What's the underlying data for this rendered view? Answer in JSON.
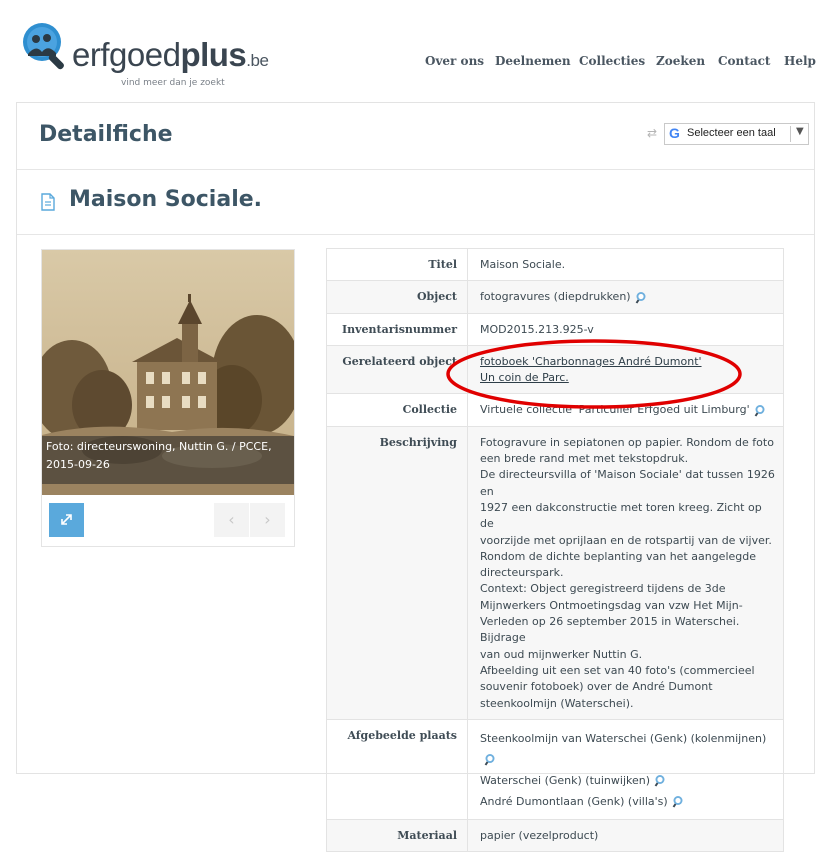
{
  "header": {
    "logo_main": "erfgoed",
    "logo_bold": "plus",
    "logo_tld": ".be",
    "tagline": "vind meer dan je zoekt",
    "nav": [
      "Over ons",
      "Deelnemen",
      "Collecties",
      "Zoeken",
      "Contact",
      "Help"
    ]
  },
  "page": {
    "title": "Detailfiche",
    "object_title": "Maison Sociale."
  },
  "translate": {
    "logo_letter": "G",
    "label": "Selecteer een taal",
    "arrow": "▼",
    "swap": "⇄"
  },
  "image": {
    "caption": "Foto: directeurswoning, Nuttin G. / PCCE, 2015-09-26",
    "prev": "‹",
    "next": "›"
  },
  "details": {
    "titel": {
      "label": "Titel",
      "value": "Maison Sociale."
    },
    "object": {
      "label": "Object",
      "value": "fotogravures (diepdrukken)"
    },
    "inventaris": {
      "label": "Inventarisnummer",
      "value": "MOD2015.213.925-v"
    },
    "gerelateerd": {
      "label": "Gerelateerd object",
      "links": [
        "fotoboek 'Charbonnages André Dumont'",
        "Un coin de Parc."
      ]
    },
    "collectie": {
      "label": "Collectie",
      "value": "Virtuele collectie 'Particulier Erfgoed uit Limburg'"
    },
    "beschrijving": {
      "label": "Beschrijving",
      "lines": [
        "Fotogravure in sepiatonen op papier. Rondom de foto",
        "een brede rand met met tekstopdruk.",
        "De directeursvilla of 'Maison Sociale' dat tussen 1926 en",
        "1927 een dakconstructie met toren kreeg. Zicht op de",
        "voorzijde met oprijlaan en de rotspartij van de vijver.",
        "Rondom de dichte beplanting van het aangelegde",
        "directeurspark.",
        "Context: Object geregistreerd tijdens de 3de",
        "Mijnwerkers Ontmoetingsdag van vzw Het Mijn-",
        "Verleden op 26 september 2015 in Waterschei. Bijdrage",
        "van oud mijnwerker Nuttin G.",
        "Afbeelding uit een set van 40 foto's (commercieel",
        "souvenir fotoboek) over de André Dumont",
        "steenkoolmijn (Waterschei)."
      ]
    },
    "afgebeelde": {
      "label": "Afgebeelde plaats",
      "values": [
        "Steenkoolmijn van Waterschei (Genk) (kolenmijnen)",
        "Waterschei (Genk) (tuinwijken)",
        "André Dumontlaan (Genk) (villa's)"
      ]
    },
    "materiaal": {
      "label": "Materiaal",
      "value": "papier (vezelproduct)"
    }
  },
  "colors": {
    "title": "#3d5666",
    "accent_button": "#5aa9dc",
    "annotation": "#e00000",
    "logo_blue": "#2f8fd0"
  }
}
